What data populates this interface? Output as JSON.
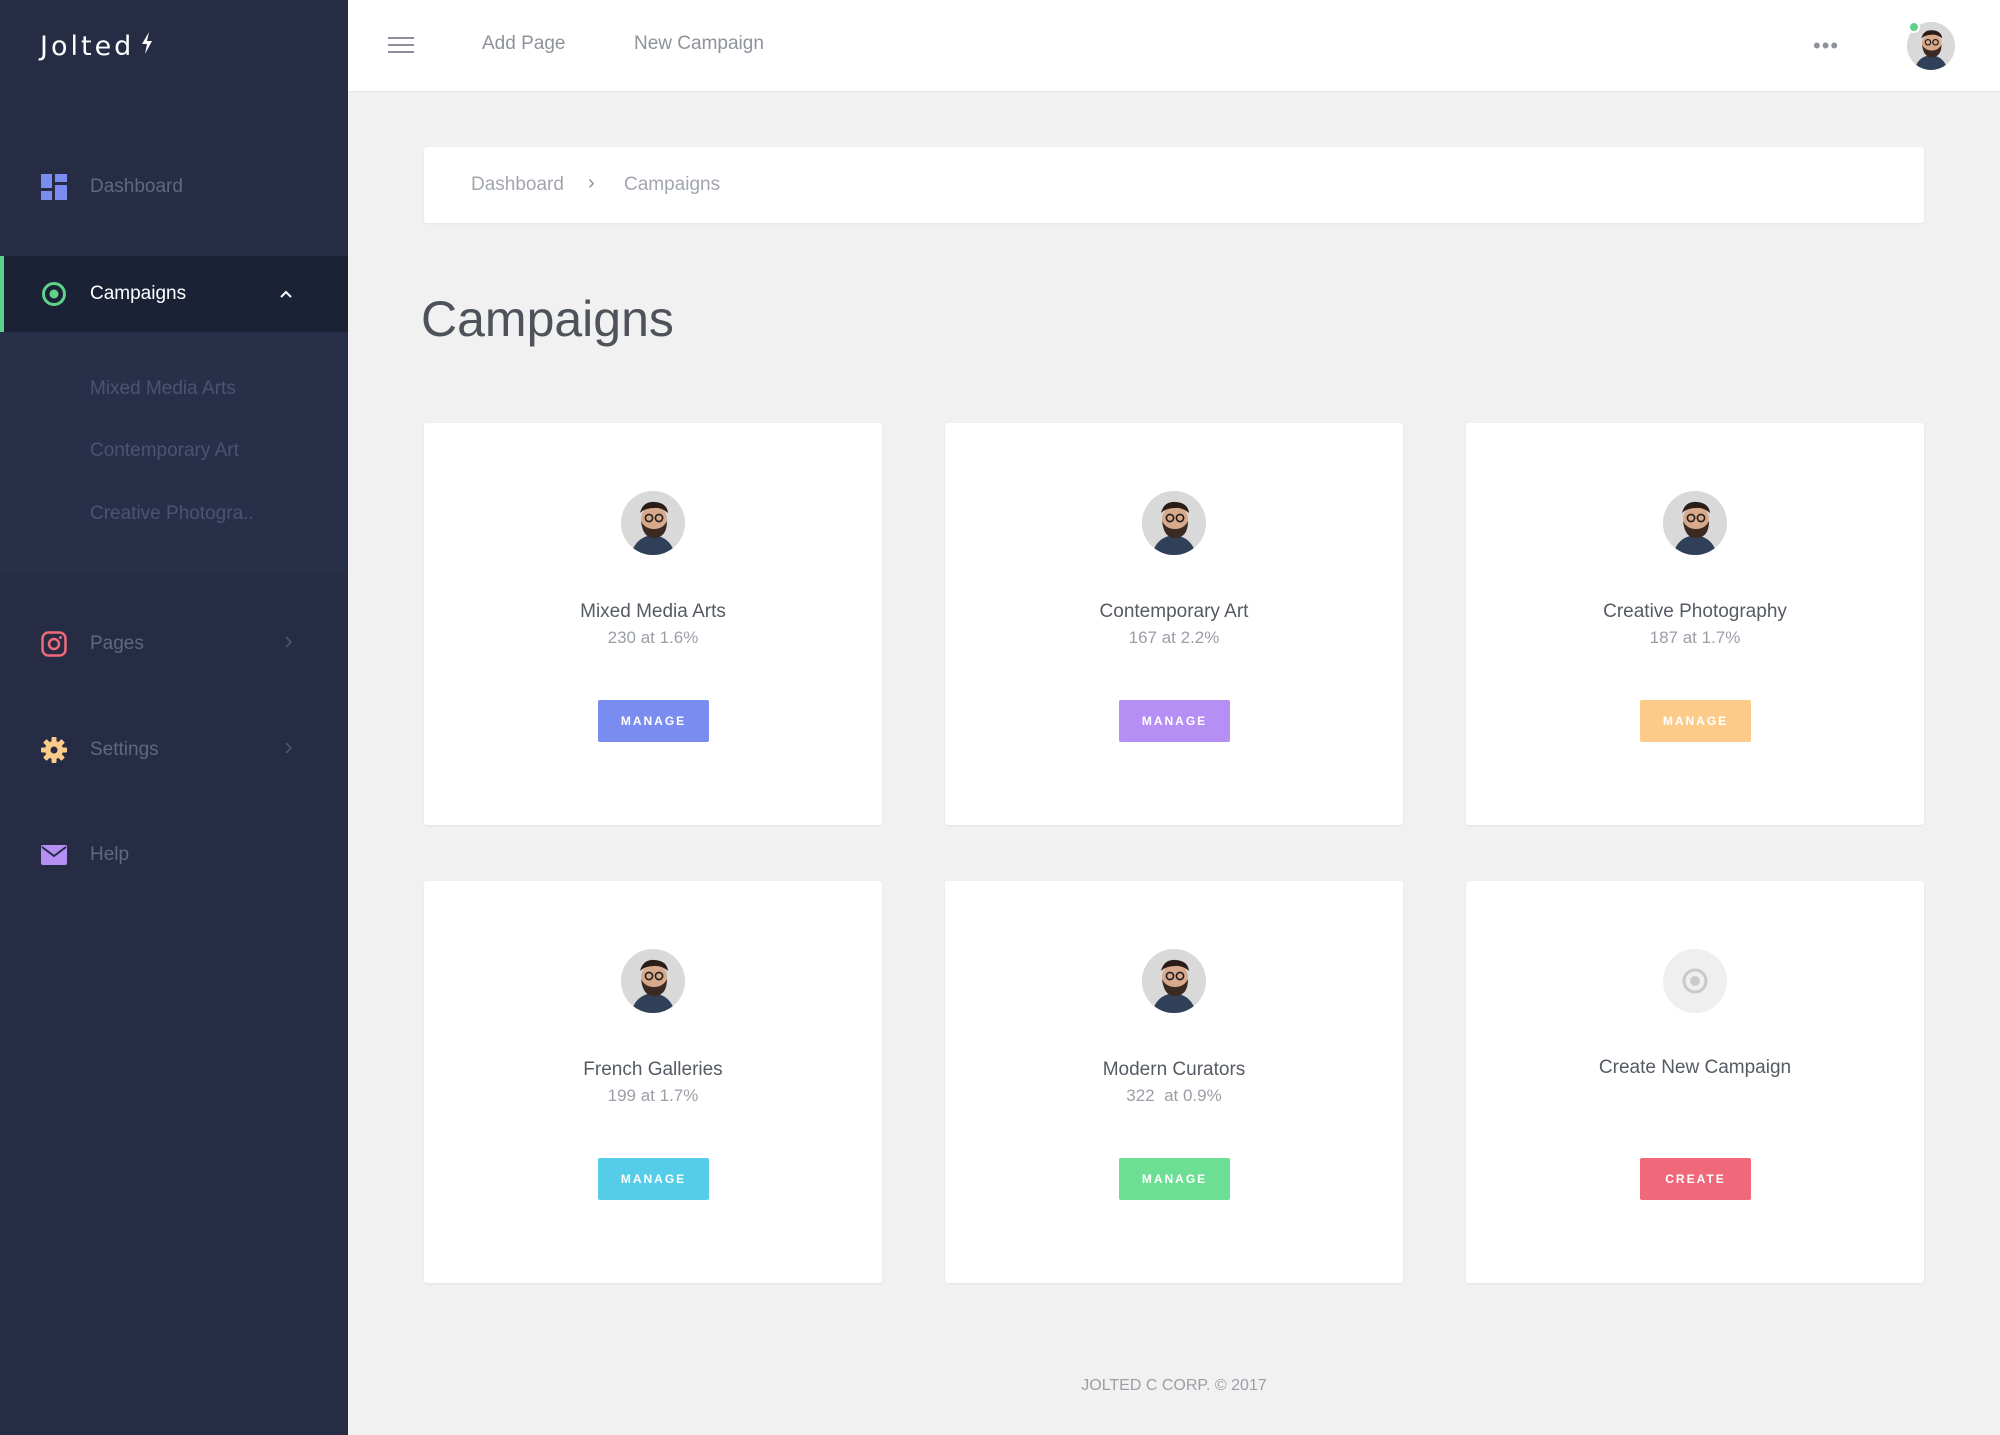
{
  "brand": {
    "name": "Jolted",
    "bolt": "⚡"
  },
  "sidebar": {
    "items": [
      {
        "label": "Dashboard"
      },
      {
        "label": "Campaigns"
      },
      {
        "label": "Pages"
      },
      {
        "label": "Settings"
      },
      {
        "label": "Help"
      }
    ],
    "subitems": [
      {
        "label": "Mixed Media Arts"
      },
      {
        "label": "Contemporary Art"
      },
      {
        "label": "Creative Photogra.."
      }
    ]
  },
  "topbar": {
    "links": [
      "Add Page",
      "New Campaign"
    ],
    "more": "•••"
  },
  "breadcrumb": {
    "items": [
      "Dashboard",
      "Campaigns"
    ],
    "separator": "›"
  },
  "page": {
    "title": "Campaigns"
  },
  "cards": [
    {
      "name": "Mixed Media Arts",
      "stat": "230 at 1.6%",
      "button": "MANAGE",
      "color": "#7b8cf0"
    },
    {
      "name": "Contemporary Art",
      "stat": "167 at 2.2%",
      "button": "MANAGE",
      "color": "#b68ff5"
    },
    {
      "name": "Creative Photography",
      "stat": "187 at 1.7%",
      "button": "MANAGE",
      "color": "#fccb8a"
    },
    {
      "name": "French Galleries",
      "stat": "199 at 1.7%",
      "button": "MANAGE",
      "color": "#55cde8"
    },
    {
      "name": "Modern Curators",
      "stat": "322  at 0.9%",
      "button": "MANAGE",
      "color": "#6cdf94"
    },
    {
      "name": "Create New Campaign",
      "button": "CREATE",
      "color": "#f0697a"
    }
  ],
  "footer": {
    "text": "JOLTED C CORP. © 2017"
  },
  "colors": {
    "sidebar": "#252c43",
    "active_accent": "#5fd28a",
    "background": "#f1f1f1"
  }
}
